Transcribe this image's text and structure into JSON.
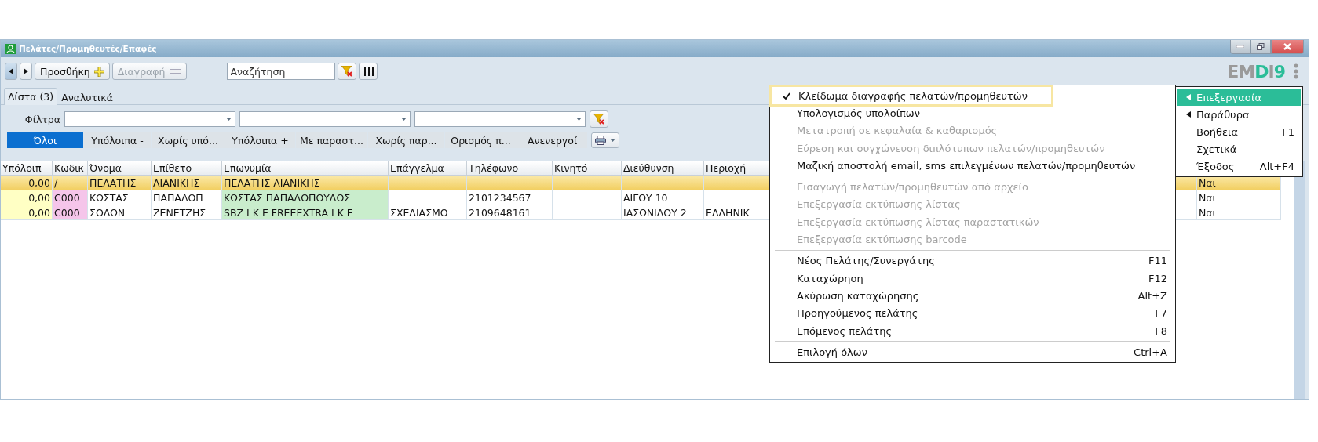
{
  "window": {
    "title": "Πελάτες/Προμηθευτές/Επαφές"
  },
  "toolbar": {
    "add_button": "Προσθήκη",
    "delete_button": {
      "label": "Διαγραφή",
      "disabled": true
    },
    "search": {
      "placeholder": "Αναζήτηση"
    },
    "logo": "EMDI9"
  },
  "tabs": [
    {
      "label": "Λίστα (3)",
      "selected": true
    },
    {
      "label": "Αναλυτικά",
      "selected": false
    }
  ],
  "filters": {
    "label": "Φίλτρα"
  },
  "segments": [
    {
      "label": "Όλοι",
      "selected": true
    },
    {
      "label": "Υπόλοιπα -",
      "selected": false
    },
    {
      "label": "Χωρίς υπό...",
      "selected": false
    },
    {
      "label": "Υπόλοιπα +",
      "selected": false
    },
    {
      "label": "Με παραστ...",
      "selected": false
    },
    {
      "label": "Χωρίς παρ...",
      "selected": false
    },
    {
      "label": "Ορισμός π...",
      "selected": false
    },
    {
      "label": "Ανενεργοί",
      "selected": false
    }
  ],
  "table": {
    "columns": [
      "Υπόλοιπ",
      "Κωδικ",
      "Όνομα",
      "Επίθετο",
      "Επωνυμία",
      "Επάγγελμα",
      "Τηλέφωνο",
      "Κινητό",
      "Διεύθυνση",
      "Περιοχή",
      null
    ],
    "rows": [
      {
        "selected": true,
        "cells": [
          "0,00",
          "/",
          "ΠΕΛΑΤΗΣ",
          "ΛΙΑΝΙΚΗΣ",
          "ΠΕΛΑΤΗΣ ΛΙΑΝΙΚΗΣ",
          null,
          null,
          null,
          null,
          null,
          "Ναι"
        ]
      },
      {
        "selected": false,
        "cells": [
          "0,00",
          "C000",
          "ΚΩΣΤΑΣ",
          "ΠΑΠΑΔΟΠ",
          "ΚΩΣΤΑΣ ΠΑΠΑΔΟΠΟΥΛΟΣ",
          null,
          "2101234567",
          null,
          "ΑΙΓΟΥ 10",
          null,
          "Ναι"
        ]
      },
      {
        "selected": false,
        "cells": [
          "0,00",
          "C000",
          "ΣΟΛΩΝ",
          "ΖΕΝΕΤΖΗΣ",
          "SBZ I K E  FREEEXTRA I K E",
          "ΣΧΕΔΙΑΣΜΟ",
          "2109648161",
          null,
          "ΙΑΣΩΝΙΔΟΥ 2",
          "ΕΛΛΗΝΙΚ",
          "Ναι"
        ]
      }
    ]
  },
  "context_menu": [
    {
      "label": "Κλείδωμα διαγραφής πελατών/προμηθευτών",
      "checked": true,
      "disabled": false,
      "highlighted": true
    },
    {
      "label": "Υπολογισμός υπολοίπων",
      "checked": false,
      "disabled": false,
      "highlighted": false
    },
    {
      "label": "Μετατροπή σε κεφαλαία & καθαρισμός",
      "checked": false,
      "disabled": true,
      "highlighted": false
    },
    {
      "label": "Εύρεση και συγχώνευση διπλότυπων πελατών/προμηθευτών",
      "checked": false,
      "disabled": true,
      "highlighted": false
    },
    {
      "label": "Μαζική αποστολή email, sms επιλεγμένων πελατών/προμηθευτών",
      "checked": false,
      "disabled": false,
      "highlighted": false,
      "separator_after": true
    },
    {
      "label": "Εισαγωγή πελατών/προμηθευτών από αρχείο",
      "checked": false,
      "disabled": true,
      "highlighted": false
    },
    {
      "label": "Επεξεργασία εκτύπωσης λίστας",
      "checked": false,
      "disabled": true,
      "highlighted": false
    },
    {
      "label": "Επεξεργασία εκτύπωσης λίστας παραστατικών",
      "checked": false,
      "disabled": true,
      "highlighted": false
    },
    {
      "label": "Επεξεργασία εκτύπωσης barcode",
      "checked": false,
      "disabled": true,
      "highlighted": false,
      "separator_after": true
    },
    {
      "label": "Νέος Πελάτης/Συνεργάτης",
      "shortcut": "F11",
      "checked": false,
      "disabled": false,
      "highlighted": false
    },
    {
      "label": "Καταχώρηση",
      "shortcut": "F12",
      "checked": false,
      "disabled": false,
      "highlighted": false
    },
    {
      "label": "Ακύρωση καταχώρησης",
      "shortcut": "Alt+Z",
      "checked": false,
      "disabled": false,
      "highlighted": false
    },
    {
      "label": "Προηγούμενος πελάτης",
      "shortcut": "F7",
      "checked": false,
      "disabled": false,
      "highlighted": false
    },
    {
      "label": "Επόμενος πελάτης",
      "shortcut": "F8",
      "checked": false,
      "disabled": false,
      "highlighted": false,
      "separator_after": true
    },
    {
      "label": "Επιλογή όλων",
      "shortcut": "Ctrl+A",
      "checked": false,
      "disabled": false,
      "highlighted": false
    }
  ],
  "main_menu": [
    {
      "label": "Επεξεργασία",
      "submenu": true,
      "selected": true
    },
    {
      "label": "Παράθυρα",
      "submenu": true,
      "selected": false
    },
    {
      "label": "Βοήθεια",
      "shortcut": "F1",
      "submenu": false,
      "selected": false
    },
    {
      "label": "Σχετικά",
      "submenu": false,
      "selected": false
    },
    {
      "label": "Έξοδος",
      "shortcut": "Alt+F4",
      "submenu": false,
      "selected": false
    }
  ]
}
